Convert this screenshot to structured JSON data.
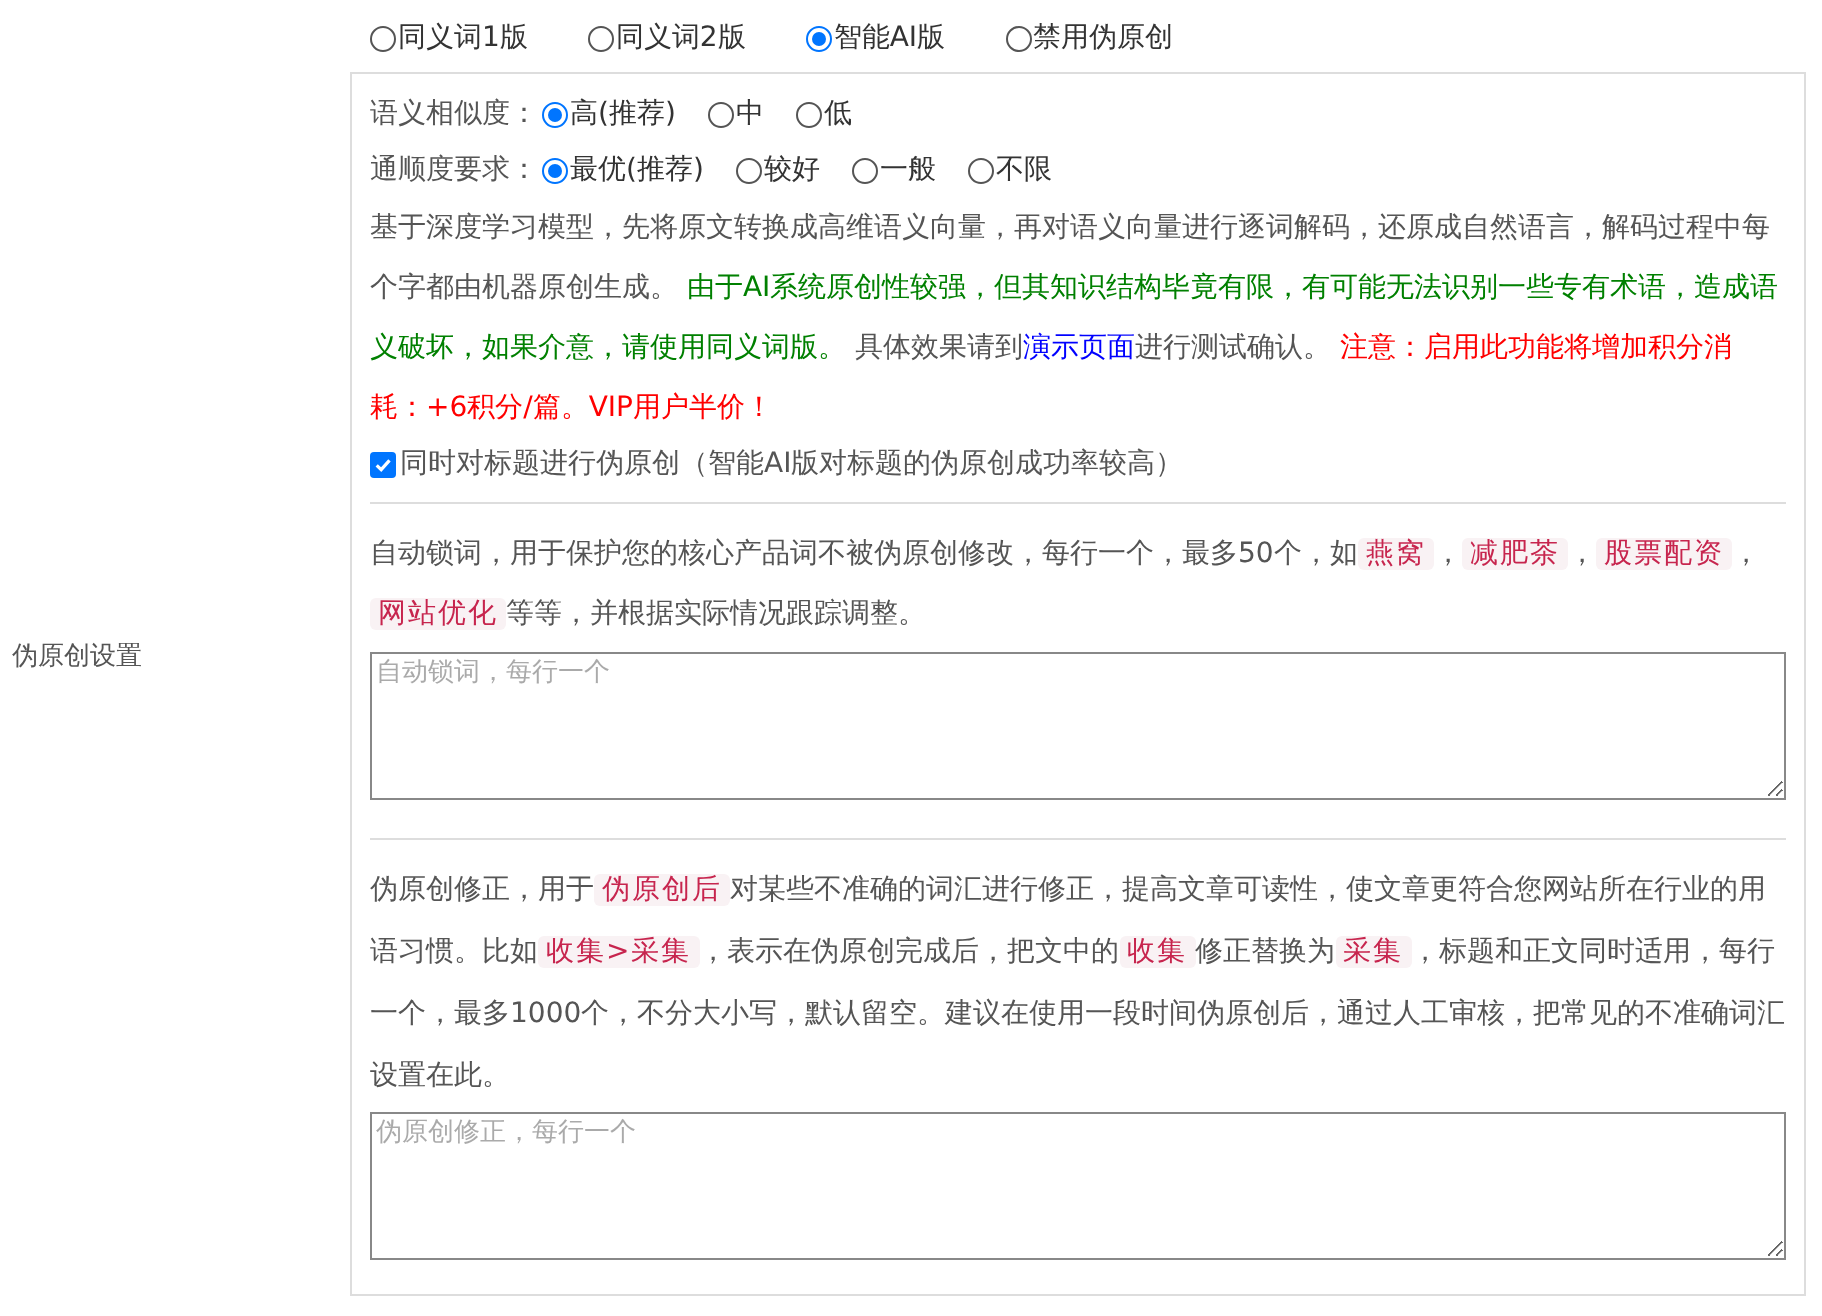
{
  "mode_options": [
    {
      "label": "同义词1版",
      "selected": false
    },
    {
      "label": "同义词2版",
      "selected": false
    },
    {
      "label": "智能AI版",
      "selected": true
    },
    {
      "label": "禁用伪原创",
      "selected": false
    }
  ],
  "similarity": {
    "label": "语义相似度：",
    "options": [
      {
        "label": "高(推荐)",
        "selected": true
      },
      {
        "label": "中",
        "selected": false
      },
      {
        "label": "低",
        "selected": false
      }
    ]
  },
  "fluency": {
    "label": "通顺度要求：",
    "options": [
      {
        "label": "最优(推荐)",
        "selected": true
      },
      {
        "label": "较好",
        "selected": false
      },
      {
        "label": "一般",
        "selected": false
      },
      {
        "label": "不限",
        "selected": false
      }
    ]
  },
  "ai_description": [
    {
      "kind": "plain",
      "text": "基于深度学习模型，先将原文转换成高维语义向量，再对语义向量进行逐词解码，还原成自然语言，解码过程中每个字都由机器原创生成。 "
    },
    {
      "kind": "green",
      "text": "由于AI系统原创性较强，但其知识结构毕竟有限，有可能无法识别一些专有术语，造成语义破坏，如果介意，请使用同义词版。"
    },
    {
      "kind": "plain",
      "text": " 具体效果请到"
    },
    {
      "kind": "link",
      "text": "演示页面"
    },
    {
      "kind": "plain",
      "text": "进行测试确认。 "
    },
    {
      "kind": "red",
      "text": "注意：启用此功能将增加积分消耗：+6积分/篇。VIP用户半价！"
    }
  ],
  "title_checkbox": {
    "label": "同时对标题进行伪原创（智能AI版对标题的伪原创成功率较高）",
    "checked": true
  },
  "section_label": "伪原创设置",
  "lock_words": {
    "description": [
      {
        "kind": "plain",
        "text": "自动锁词，用于保护您的核心产品词不被伪原创修改，每行一个，最多50个，如"
      },
      {
        "kind": "code",
        "text": "燕窝"
      },
      {
        "kind": "plain",
        "text": "，"
      },
      {
        "kind": "code",
        "text": "减肥茶"
      },
      {
        "kind": "plain",
        "text": "，"
      },
      {
        "kind": "code",
        "text": "股票配资"
      },
      {
        "kind": "plain",
        "text": "，"
      },
      {
        "kind": "code",
        "text": "网站优化"
      },
      {
        "kind": "plain",
        "text": "等等，并根据实际情况跟踪调整。"
      }
    ],
    "placeholder": "自动锁词，每行一个"
  },
  "corrections": {
    "description": [
      {
        "kind": "plain",
        "text": "伪原创修正，用于"
      },
      {
        "kind": "code",
        "text": "伪原创后"
      },
      {
        "kind": "plain",
        "text": "对某些不准确的词汇进行修正，提高文章可读性，使文章更符合您网站所在行业的用语习惯。比如"
      },
      {
        "kind": "code",
        "text": "收集>采集"
      },
      {
        "kind": "plain",
        "text": "，表示在伪原创完成后，把文中的"
      },
      {
        "kind": "code",
        "text": "收集"
      },
      {
        "kind": "plain",
        "text": "修正替换为"
      },
      {
        "kind": "code",
        "text": "采集"
      },
      {
        "kind": "plain",
        "text": "，标题和正文同时适用，每行一个，最多1000个，不分大小写，默认留空。建议在使用一段时间伪原创后，通过人工审核，把常见的不准确词汇设置在此。"
      }
    ],
    "placeholder": "伪原创修正，每行一个"
  }
}
